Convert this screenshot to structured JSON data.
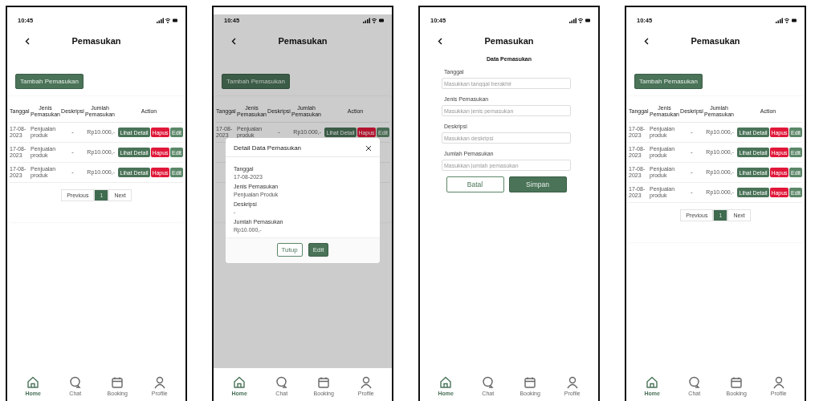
{
  "screens": [
    {
      "kind": "list",
      "time": "10:45",
      "title": "Pemasukan",
      "add_button": "Tambah Pemasukan",
      "columns": [
        "Tanggal",
        "Jenis Pemasukan",
        "Deskripsi",
        "Jumlah Pemasukan",
        "Action"
      ],
      "rows": [
        {
          "cells": [
            "17-08-2023",
            "Penjualan produk",
            "-",
            "Rp10.000,-"
          ],
          "actions": [
            {
              "label": "Lihat Detail",
              "kind": "view"
            },
            {
              "label": "Hapus",
              "kind": "delete"
            },
            {
              "label": "Edit",
              "kind": "edit"
            }
          ]
        },
        {
          "cells": [
            "17-08-2023",
            "Penjualan produk",
            "-",
            "Rp10.000,-"
          ],
          "actions": [
            {
              "label": "Lihat Detail",
              "kind": "view"
            },
            {
              "label": "Hapus",
              "kind": "delete"
            },
            {
              "label": "Edit",
              "kind": "edit"
            }
          ]
        },
        {
          "cells": [
            "17-08-2023",
            "Penjualan produk",
            "-",
            "Rp10.000,-"
          ],
          "actions": [
            {
              "label": "Lihat Detail",
              "kind": "view"
            },
            {
              "label": "Hapus",
              "kind": "delete"
            },
            {
              "label": "Edit",
              "kind": "edit"
            }
          ]
        }
      ],
      "pagination": {
        "previous": "Previous",
        "pages": [
          {
            "label": "1",
            "selected": true
          }
        ],
        "next": "Next"
      },
      "nav": [
        {
          "label": "Home",
          "selected": true
        },
        {
          "label": "Chat",
          "selected": false
        },
        {
          "label": "Booking",
          "selected": false
        },
        {
          "label": "Profile",
          "selected": false
        }
      ]
    },
    {
      "kind": "detail",
      "time": "10:45",
      "title": "Pemasukan",
      "add_button": "Tambah Pemasukan",
      "columns": [
        "Tanggal",
        "Jenis Pemasukan",
        "Deskripsi",
        "Jumlah Pemasukan",
        "Action"
      ],
      "rows": [
        {
          "cells": [
            "17-08-2023",
            "Penjualan produk",
            "-",
            "Rp10.000,-"
          ],
          "actions": [
            {
              "label": "Lihat Detail",
              "kind": "view"
            },
            {
              "label": "Hapus",
              "kind": "delete"
            },
            {
              "label": "Edit",
              "kind": "edit"
            }
          ]
        }
      ],
      "modal": {
        "title": "Detail Data Pemasukan",
        "fields": [
          {
            "label": "Tanggal",
            "value": "17-08-2023"
          },
          {
            "label": "Jenis Pemasukan",
            "value": "Penjualan Produk"
          },
          {
            "label": "Deskripsi",
            "value": "-"
          },
          {
            "label": "Jumlah Pemasukan",
            "value": "Rp10.000,-"
          }
        ],
        "buttons": [
          {
            "label": "Tutup",
            "kind": "outline"
          },
          {
            "label": "Edit",
            "kind": "filled"
          }
        ]
      },
      "nav": [
        {
          "label": "Home",
          "selected": true
        },
        {
          "label": "Chat",
          "selected": false
        },
        {
          "label": "Booking",
          "selected": false
        },
        {
          "label": "Profile",
          "selected": false
        }
      ]
    },
    {
      "kind": "form",
      "time": "10:45",
      "title": "Pemasukan",
      "form_title": "Data Pemasukan",
      "fields": [
        {
          "label": "Tanggal",
          "placeholder": "Masukkan tanggal berakhir"
        },
        {
          "label": "Jenis Pemasukan",
          "placeholder": "Masukkan jenis pemasukan"
        },
        {
          "label": "Deskripsi",
          "placeholder": "Masukkan deskripsi"
        },
        {
          "label": "Jumlah Pemasukan",
          "placeholder": "Masukkan jumlah pemasukan"
        }
      ],
      "buttons": [
        {
          "label": "Batal",
          "kind": "outline"
        },
        {
          "label": "Simpan",
          "kind": "filled"
        }
      ],
      "nav": [
        {
          "label": "Home",
          "selected": true
        },
        {
          "label": "Chat",
          "selected": false
        },
        {
          "label": "Booking",
          "selected": false
        },
        {
          "label": "Profile",
          "selected": false
        }
      ]
    },
    {
      "kind": "list",
      "time": "10:45",
      "title": "Pemasukan",
      "add_button": "Tambah Pemasukan",
      "columns": [
        "Tanggal",
        "Jenis Pemasukan",
        "Deskripsi",
        "Jumlah Pemasukan",
        "Action"
      ],
      "rows": [
        {
          "cells": [
            "17-08-2023",
            "Penjualan produk",
            "-",
            "Rp10.000,-"
          ],
          "actions": [
            {
              "label": "Lihat Detail",
              "kind": "view"
            },
            {
              "label": "Hapus",
              "kind": "delete"
            },
            {
              "label": "Edit",
              "kind": "edit"
            }
          ]
        },
        {
          "cells": [
            "17-08-2023",
            "Penjualan produk",
            "-",
            "Rp10.000,-"
          ],
          "actions": [
            {
              "label": "Lihat Detail",
              "kind": "view"
            },
            {
              "label": "Hapus",
              "kind": "delete"
            },
            {
              "label": "Edit",
              "kind": "edit"
            }
          ]
        },
        {
          "cells": [
            "17-08-2023",
            "Penjualan produk",
            "-",
            "Rp10.000,-"
          ],
          "actions": [
            {
              "label": "Lihat Detail",
              "kind": "view"
            },
            {
              "label": "Hapus",
              "kind": "delete"
            },
            {
              "label": "Edit",
              "kind": "edit"
            }
          ]
        },
        {
          "cells": [
            "17-08-2023",
            "Penjualan produk",
            "-",
            "Rp10.000,-"
          ],
          "actions": [
            {
              "label": "Lihat Detail",
              "kind": "view"
            },
            {
              "label": "Hapus",
              "kind": "delete"
            },
            {
              "label": "Edit",
              "kind": "edit"
            }
          ]
        }
      ],
      "pagination": {
        "previous": "Previous",
        "pages": [
          {
            "label": "1",
            "selected": true
          }
        ],
        "next": "Next"
      },
      "nav": [
        {
          "label": "Home",
          "selected": true
        },
        {
          "label": "Chat",
          "selected": false
        },
        {
          "label": "Booking",
          "selected": false
        },
        {
          "label": "Profile",
          "selected": false
        }
      ]
    }
  ]
}
